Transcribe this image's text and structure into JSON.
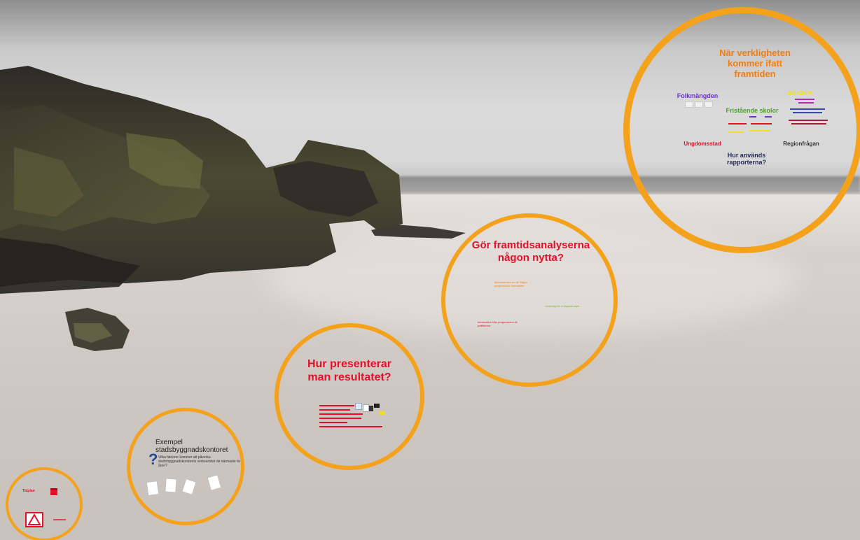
{
  "frames": {
    "f1": {
      "title": "När verkligheten kommer ifatt framtiden",
      "topics": {
        "folkmangden": "Folkmängden",
        "bostader": "Bostäder",
        "fristaende_skolor": "Fristående skolor",
        "ungdomsstad": "Ungdomsstad",
        "regionfragan": "Regionfrågan",
        "hur_anvands": "Hur används rapporterna?"
      }
    },
    "f2": {
      "title": "Gör framtidsanalyserna någon nytta?",
      "notes": {
        "orange": "Medvetenhet om de frågor prognoserna framställer",
        "green": "Underlag för nulägesanalys",
        "red": "Information från prognoserna till politikerna"
      }
    },
    "f3": {
      "title": "Hur presenterar man resultatet?"
    },
    "f4": {
      "title_line1": "Exempel",
      "title_line2": "stadsbyggnadskontoret",
      "question_mark": "?",
      "body": "Vilka faktorer kommer att påverka stadsbyggnadskontorets verksamhet de närmaste tio åren?"
    },
    "f5": {
      "label": "Tidplan"
    }
  },
  "colors": {
    "ring": "#f4a21c",
    "orange": "#f07d12",
    "red": "#e3102a",
    "green": "#76b82a",
    "purple": "#6a2fd6",
    "navy": "#1e2a5a",
    "blue": "#1f4a9c",
    "yellow": "#f0e020"
  }
}
